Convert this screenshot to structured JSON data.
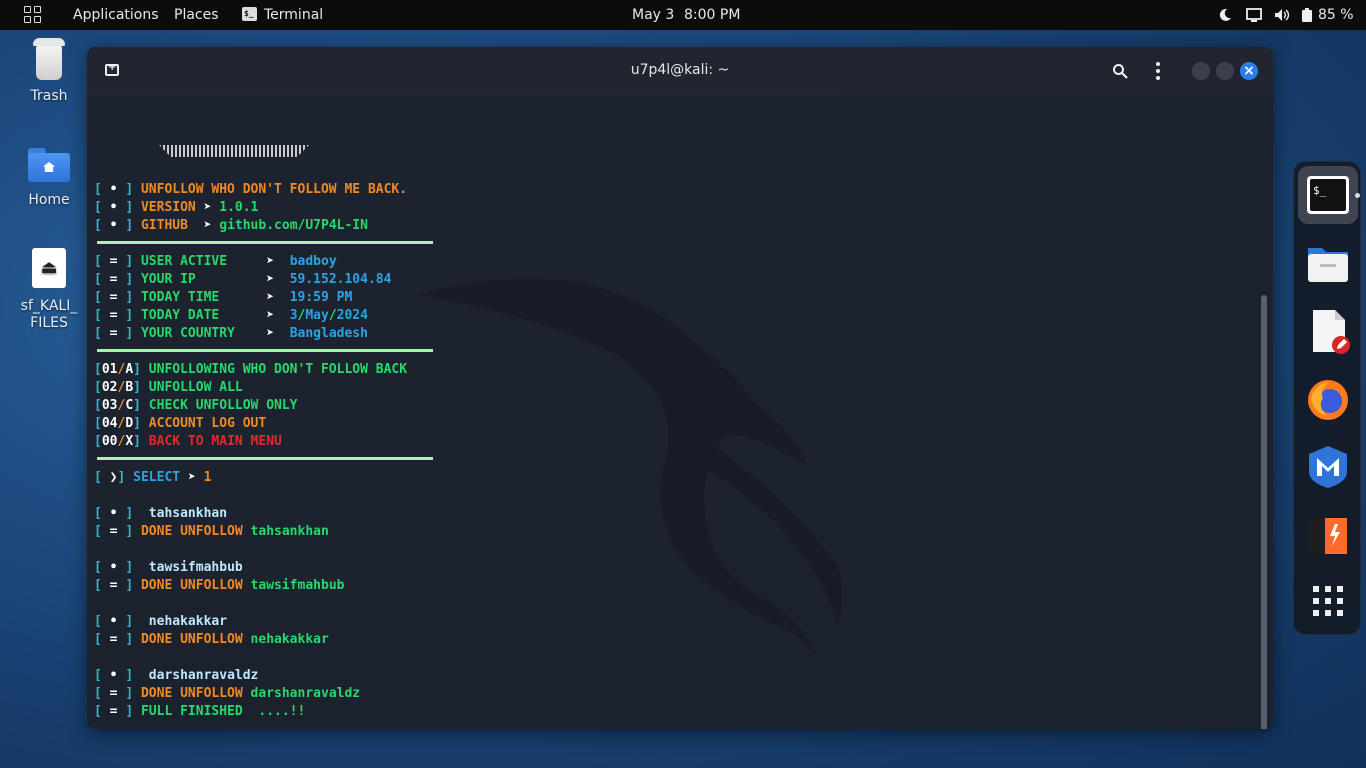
{
  "topbar": {
    "applications": "Applications",
    "places": "Places",
    "terminal_app": "Terminal",
    "clock_date": "May 3",
    "clock_time": "8:00 PM",
    "battery": "85 %"
  },
  "desktop": {
    "trash": "Trash",
    "home": "Home",
    "sf_line1": "sf_KALI_",
    "sf_line2": "FILES"
  },
  "window": {
    "title": "u7p4l@kali: ~"
  },
  "terminal": {
    "info": [
      {
        "label": "UNFOLLOW WHO DON'T FOLLOW ME BACK.",
        "value": ""
      },
      {
        "label": "VERSION",
        "value": "1.0.1"
      },
      {
        "label": "GITHUB ",
        "value": "github.com/U7P4L-IN"
      }
    ],
    "user": [
      {
        "label": "USER ACTIVE   ",
        "value": "badboy"
      },
      {
        "label": "YOUR IP       ",
        "value": "59.152.104.84"
      },
      {
        "label": "TODAY TIME    ",
        "value": "19:59 PM"
      },
      {
        "label": "TODAY DATE    ",
        "value_a": "3",
        "value_b": "May",
        "value_c": "2024"
      },
      {
        "label": "YOUR COUNTRY  ",
        "value": "Bangladesh"
      }
    ],
    "menu": [
      {
        "num": "01",
        "key": "A",
        "text": "UNFOLLOWING WHO DON'T FOLLOW BACK"
      },
      {
        "num": "02",
        "key": "B",
        "text": "UNFOLLOW ALL"
      },
      {
        "num": "03",
        "key": "C",
        "text": "CHECK UNFOLLOW ONLY"
      },
      {
        "num": "04",
        "key": "D",
        "text": "ACCOUNT LOG OUT"
      },
      {
        "num": "00",
        "key": "X",
        "text": "BACK TO MAIN MENU"
      }
    ],
    "select_label": "SELECT",
    "select_value": "1",
    "done_label": "DONE UNFOLLOW",
    "accounts": [
      "tahsankhan",
      "tawsifmahbub",
      "nehakakkar",
      "darshanravaldz"
    ],
    "finished": "FULL FINISHED  ....!!",
    "prompt_user": "u7p4l",
    "prompt_host": "kali",
    "prompt_dir": "~",
    "prompt_symbol": "$"
  },
  "colors": {
    "bracket": "#2fb8c9",
    "orange": "#f08a24",
    "green": "#27d96b",
    "cyan": "#2ba4e6",
    "red": "#e8262b",
    "dock_bg": "#14181f"
  },
  "dock": [
    "terminal-icon",
    "files-icon",
    "text-editor-icon",
    "firefox-icon",
    "metasploit-icon",
    "burpsuite-icon",
    "app-grid-icon"
  ]
}
